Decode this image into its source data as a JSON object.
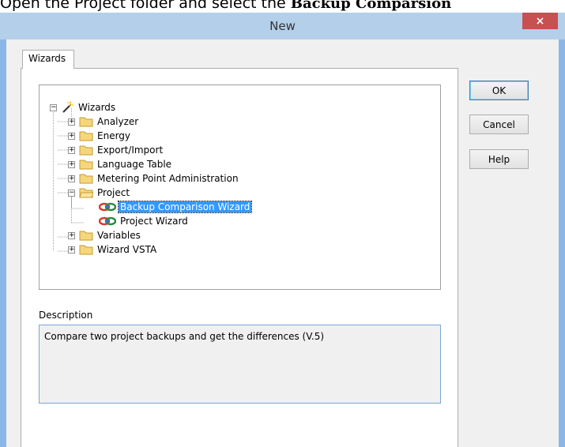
{
  "doc_text": {
    "prefix": "Open the Project folder and select the ",
    "bold": "Backup Comparsion"
  },
  "window": {
    "title": "New",
    "close_glyph": "×"
  },
  "tabs": [
    {
      "label": "Wizards"
    }
  ],
  "tree": {
    "root": {
      "label": "Wizards",
      "icon": "magic-wand-icon",
      "expander": "−"
    },
    "items": [
      {
        "label": "Analyzer",
        "icon": "folder-icon",
        "expander": "+"
      },
      {
        "label": "Energy",
        "icon": "folder-icon",
        "expander": "+"
      },
      {
        "label": "Export/Import",
        "icon": "folder-icon",
        "expander": "+"
      },
      {
        "label": "Language Table",
        "icon": "folder-icon",
        "expander": "+"
      },
      {
        "label": "Metering Point Administration",
        "icon": "folder-icon",
        "expander": "+"
      },
      {
        "label": "Project",
        "icon": "folder-icon",
        "expander": "−"
      },
      {
        "label": "Backup Comparison Wizard",
        "icon": "wizard-icon",
        "selected": true
      },
      {
        "label": "Project Wizard",
        "icon": "wizard-icon"
      },
      {
        "label": "Variables",
        "icon": "folder-icon",
        "expander": "+"
      },
      {
        "label": "Wizard VSTA",
        "icon": "folder-icon",
        "expander": "+"
      }
    ]
  },
  "description": {
    "label": "Description",
    "text": "Compare two project backups and get the differences  (V.5)"
  },
  "buttons": {
    "ok": "OK",
    "cancel": "Cancel",
    "help": "Help"
  },
  "colors": {
    "title_bar": "#b4cfe9",
    "close_button": "#c75050",
    "selection": "#3399ff",
    "folder": "#f5d77b"
  }
}
